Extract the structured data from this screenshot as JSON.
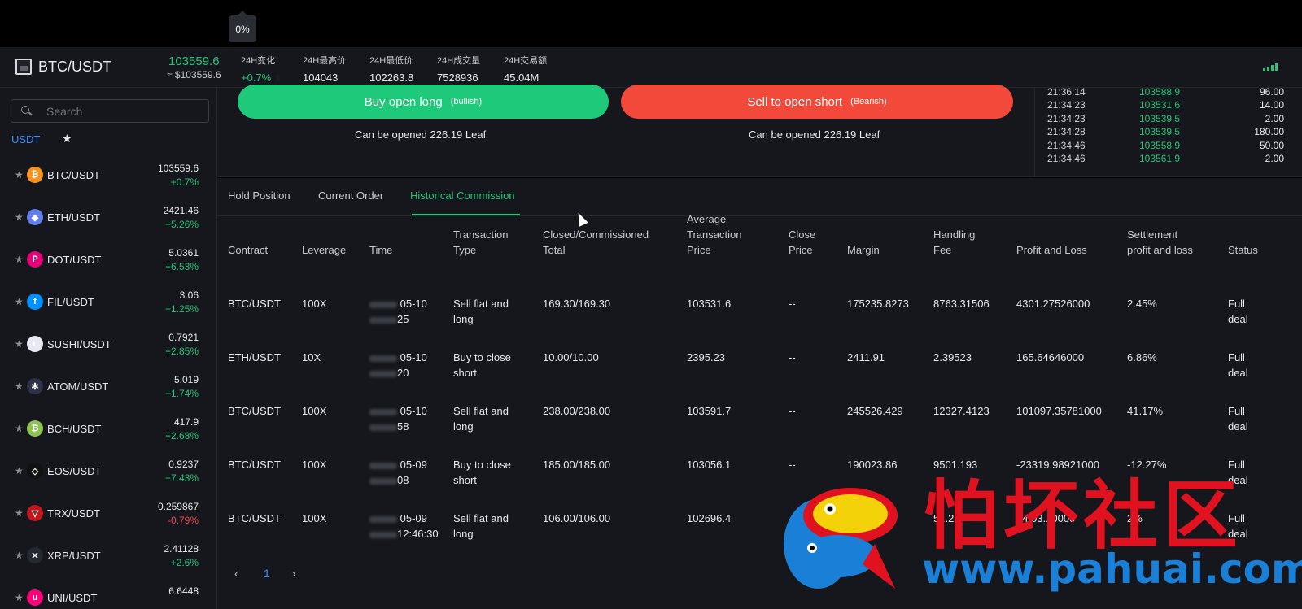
{
  "tooltip": "0%",
  "header": {
    "pair": "BTC/USDT",
    "price": "103559.6",
    "price_fiat": "≈ $103559.6",
    "stats": [
      {
        "label": "24H变化",
        "value": "+0.7%"
      },
      {
        "label": "24H最高价",
        "value": "104043"
      },
      {
        "label": "24H最低价",
        "value": "102263.8"
      },
      {
        "label": "24H成交量",
        "value": "7528936"
      },
      {
        "label": "24H交易额",
        "value": "45.04M"
      }
    ]
  },
  "sidebar": {
    "search_placeholder": "Search",
    "tab_usdt": "USDT",
    "tab_fav": "★",
    "coins": [
      {
        "name": "BTC/USDT",
        "price": "103559.6",
        "change": "+0.7%",
        "dir": "up",
        "icon": "bitcoin-icon",
        "color": "#f7931a",
        "glyph": "₿"
      },
      {
        "name": "ETH/USDT",
        "price": "2421.46",
        "change": "+5.26%",
        "dir": "up",
        "icon": "ethereum-icon",
        "color": "#627eea",
        "glyph": "◆"
      },
      {
        "name": "DOT/USDT",
        "price": "5.0361",
        "change": "+6.53%",
        "dir": "up",
        "icon": "polkadot-icon",
        "color": "#e6007a",
        "glyph": "P"
      },
      {
        "name": "FIL/USDT",
        "price": "3.06",
        "change": "+1.25%",
        "dir": "up",
        "icon": "filecoin-icon",
        "color": "#0090ff",
        "glyph": "f"
      },
      {
        "name": "SUSHI/USDT",
        "price": "0.7921",
        "change": "+2.85%",
        "dir": "up",
        "icon": "sushi-icon",
        "color": "#e8e8f0",
        "glyph": "◐"
      },
      {
        "name": "ATOM/USDT",
        "price": "5.019",
        "change": "+1.74%",
        "dir": "up",
        "icon": "cosmos-icon",
        "color": "#2e3148",
        "glyph": "✻"
      },
      {
        "name": "BCH/USDT",
        "price": "417.9",
        "change": "+2.68%",
        "dir": "up",
        "icon": "bitcoin-cash-icon",
        "color": "#8dc351",
        "glyph": "₿"
      },
      {
        "name": "EOS/USDT",
        "price": "0.9237",
        "change": "+7.43%",
        "dir": "up",
        "icon": "eos-icon",
        "color": "#111111",
        "glyph": "◇"
      },
      {
        "name": "TRX/USDT",
        "price": "0.259867",
        "change": "-0.79%",
        "dir": "down",
        "icon": "tron-icon",
        "color": "#c4161c",
        "glyph": "▽"
      },
      {
        "name": "XRP/USDT",
        "price": "2.41128",
        "change": "+2.6%",
        "dir": "up",
        "icon": "xrp-icon",
        "color": "#23292f",
        "glyph": "✕"
      },
      {
        "name": "UNI/USDT",
        "price": "6.6448",
        "change": "",
        "dir": "up",
        "icon": "uniswap-icon",
        "color": "#ff007a",
        "glyph": "u"
      }
    ]
  },
  "trade": {
    "buy_label": "Buy open long",
    "buy_note": "(bullish)",
    "sell_label": "Sell to open short",
    "sell_note": "(Bearish)",
    "buy_available": "Can be opened 226.19 Leaf",
    "sell_available": "Can be opened 226.19 Leaf"
  },
  "recent_trades": [
    {
      "time": "21:36:14",
      "price": "103588.9",
      "qty": "96.00"
    },
    {
      "time": "21:34:23",
      "price": "103531.6",
      "qty": "14.00"
    },
    {
      "time": "21:34:23",
      "price": "103539.5",
      "qty": "2.00"
    },
    {
      "time": "21:34:28",
      "price": "103539.5",
      "qty": "180.00"
    },
    {
      "time": "21:34:46",
      "price": "103558.9",
      "qty": "50.00"
    },
    {
      "time": "21:34:46",
      "price": "103561.9",
      "qty": "2.00"
    }
  ],
  "orders": {
    "tabs": [
      "Hold Position",
      "Current Order",
      "Historical Commission"
    ],
    "active_tab": 2,
    "headers": [
      [
        "Contract"
      ],
      [
        "Leverage"
      ],
      [
        "Time"
      ],
      [
        "Transaction",
        "Type"
      ],
      [
        "Closed/Commissioned",
        "Total"
      ],
      [
        "Average",
        "Transaction",
        "Price"
      ],
      [
        "Close",
        "Price"
      ],
      [
        "Margin"
      ],
      [
        "Handling",
        "Fee"
      ],
      [
        "Profit and Loss"
      ],
      [
        "Settlement",
        "profit and loss"
      ],
      [
        "Status"
      ]
    ],
    "rows": [
      {
        "contract": "BTC/USDT",
        "leverage": "100X",
        "date": "05-10",
        "time": "25",
        "type1": "Sell flat and",
        "type2": "long",
        "total": "169.30/169.30",
        "avg": "103531.6",
        "close": "--",
        "margin": "175235.8273",
        "fee": "8763.31506",
        "pnl": "4301.27526000",
        "settle": "2.45%",
        "pnl_dir": "up",
        "status1": "Full",
        "status2": "deal"
      },
      {
        "contract": "ETH/USDT",
        "leverage": "10X",
        "date": "05-10",
        "time": "20",
        "type1": "Buy to close",
        "type2": "short",
        "total": "10.00/10.00",
        "avg": "2395.23",
        "close": "--",
        "margin": "2411.91",
        "fee": "2.39523",
        "pnl": "165.64646000",
        "settle": "6.86%",
        "pnl_dir": "up",
        "status1": "Full",
        "status2": "deal"
      },
      {
        "contract": "BTC/USDT",
        "leverage": "100X",
        "date": "05-10",
        "time": "58",
        "type1": "Sell flat and",
        "type2": "long",
        "total": "238.00/238.00",
        "avg": "103591.7",
        "close": "--",
        "margin": "245526.429",
        "fee": "12327.4123",
        "pnl": "101097.35781000",
        "settle": "41.17%",
        "pnl_dir": "up",
        "status1": "Full",
        "status2": "deal"
      },
      {
        "contract": "BTC/USDT",
        "leverage": "100X",
        "date": "05-09",
        "time": "08",
        "type1": "Buy to close",
        "type2": "short",
        "total": "185.00/185.00",
        "avg": "103056.1",
        "close": "--",
        "margin": "190023.86",
        "fee": "9501.193",
        "pnl": "-23319.98921000",
        "settle": "-12.27%",
        "pnl_dir": "down",
        "status1": "Full",
        "status2": "deal"
      },
      {
        "contract": "BTC/USDT",
        "leverage": "100X",
        "date": "05-09",
        "time": "12:46:30",
        "type1": "Sell flat and",
        "type2": "long",
        "total": "106.00/106.00",
        "avg": "102696.4",
        "close": "--",
        "margin": "10...",
        "fee": "5...27",
        "pnl": "84.03...0000",
        "settle": "2%",
        "pnl_dir": "up",
        "status1": "Full",
        "status2": "deal"
      }
    ],
    "pager": {
      "prev": "‹",
      "page": "1",
      "next": "›"
    }
  },
  "watermark": {
    "cn": "怕坏社区",
    "url": "www.pahuai.com"
  }
}
